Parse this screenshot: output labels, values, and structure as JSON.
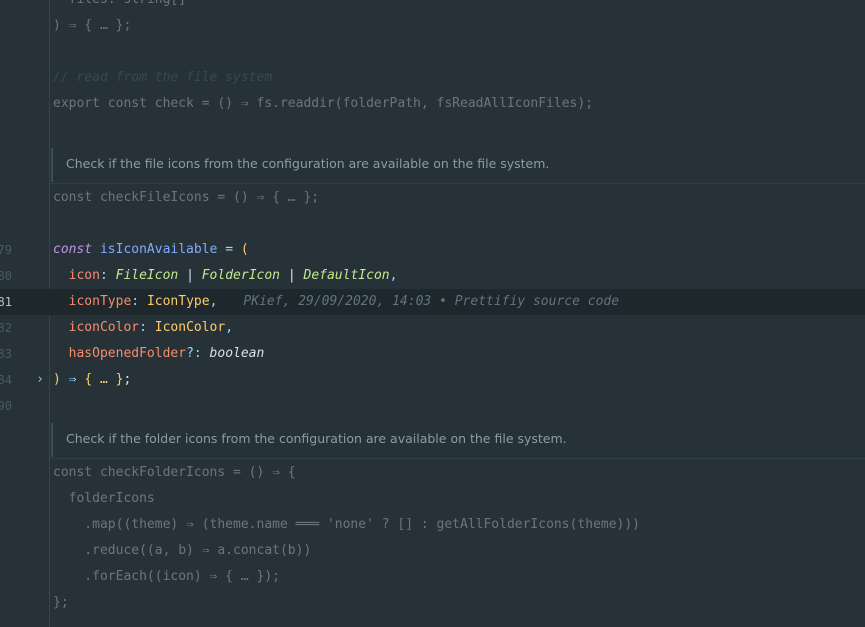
{
  "editor": {
    "lines": [
      {
        "n": "",
        "faded": true,
        "tokens": [
          {
            "t": "  files: string[]",
            "c": "c-plain"
          }
        ]
      },
      {
        "n": "",
        "faded": true,
        "tokens": [
          {
            "t": ") ⇒ { … };",
            "c": "c-plain"
          }
        ]
      },
      {
        "n": "",
        "faded": true,
        "tokens": []
      },
      {
        "n": "",
        "faded": true,
        "tokens": [
          {
            "t": "// read from the file system",
            "c": "c-comment"
          }
        ]
      },
      {
        "n": "",
        "faded": true,
        "tokens": [
          {
            "t": "export const check = () ⇒ fs.readdir(folderPath, fsReadAllIconFiles);",
            "c": "c-plain"
          }
        ]
      },
      {
        "n": "",
        "faded": true,
        "tokens": []
      },
      {
        "n": "",
        "doc": "Check if the file icons from the configuration are available on the file system."
      },
      {
        "n": "",
        "faded": true,
        "tokens": [
          {
            "t": "const checkFileIcons = () ⇒ { … };",
            "c": "c-plain"
          }
        ]
      },
      {
        "n": "",
        "faded": true,
        "tokens": []
      },
      {
        "n": "79",
        "faded": false,
        "tokens": [
          {
            "t": "const",
            "c": "c-kw"
          },
          {
            "t": " "
          },
          {
            "t": "isIconAvailable",
            "c": "c-fn"
          },
          {
            "t": " = ",
            "c": "c-punct"
          },
          {
            "t": "(",
            "c": "c-paren"
          }
        ]
      },
      {
        "n": "80",
        "faded": false,
        "tokens": [
          {
            "t": "  "
          },
          {
            "t": "icon",
            "c": "c-prop"
          },
          {
            "t": ": ",
            "c": "c-punct"
          },
          {
            "t": "FileIcon",
            "c": "c-type-i2"
          },
          {
            "t": " | ",
            "c": "c-plain"
          },
          {
            "t": "FolderIcon",
            "c": "c-type-i2"
          },
          {
            "t": " | ",
            "c": "c-plain"
          },
          {
            "t": "DefaultIcon",
            "c": "c-type-i2"
          },
          {
            "t": ",",
            "c": "c-punct"
          }
        ]
      },
      {
        "n": "81",
        "faded": false,
        "active": true,
        "tokens": [
          {
            "t": "  "
          },
          {
            "t": "iconType",
            "c": "c-prop"
          },
          {
            "t": ": ",
            "c": "c-punct"
          },
          {
            "t": "IconType",
            "c": "c-type"
          },
          {
            "t": ",",
            "c": "c-punct"
          }
        ],
        "blame": "PKief, 29/09/2020, 14:03 • Prettifiy source code"
      },
      {
        "n": "82",
        "faded": false,
        "tokens": [
          {
            "t": "  "
          },
          {
            "t": "iconColor",
            "c": "c-prop"
          },
          {
            "t": ": ",
            "c": "c-punct"
          },
          {
            "t": "IconColor",
            "c": "c-type"
          },
          {
            "t": ",",
            "c": "c-punct"
          }
        ]
      },
      {
        "n": "83",
        "faded": false,
        "tokens": [
          {
            "t": "  "
          },
          {
            "t": "hasOpenedFolder",
            "c": "c-prop"
          },
          {
            "t": "?: ",
            "c": "c-punct"
          },
          {
            "t": "boolean",
            "c": "c-bool"
          }
        ]
      },
      {
        "n": "84",
        "faded": false,
        "fold": "›",
        "tokens": [
          {
            "t": ")",
            "c": "c-paren"
          },
          {
            "t": " ⇒ ",
            "c": "c-punct"
          },
          {
            "t": "{ … }",
            "c": "c-paren"
          },
          {
            "t": ";",
            "c": "c-plain"
          }
        ]
      },
      {
        "n": "90",
        "faded": false,
        "tokens": []
      },
      {
        "n": "",
        "doc": "Check if the folder icons from the configuration are available on the file system."
      },
      {
        "n": "",
        "faded": true,
        "tokens": [
          {
            "t": "const checkFolderIcons = () ⇒ {",
            "c": "c-plain"
          }
        ]
      },
      {
        "n": "",
        "faded": true,
        "tokens": [
          {
            "t": "  folderIcons",
            "c": "c-plain"
          }
        ]
      },
      {
        "n": "",
        "faded": true,
        "tokens": [
          {
            "t": "    .map((theme) ⇒ (theme.name ═══ 'none' ? [] : getAllFolderIcons(theme)))",
            "c": "c-plain"
          }
        ]
      },
      {
        "n": "",
        "faded": true,
        "tokens": [
          {
            "t": "    .reduce((a, b) ⇒ a.concat(b))",
            "c": "c-plain"
          }
        ]
      },
      {
        "n": "",
        "faded": true,
        "tokens": [
          {
            "t": "    .forEach((icon) ⇒ { … });",
            "c": "c-plain"
          }
        ]
      },
      {
        "n": "",
        "faded": true,
        "tokens": [
          {
            "t": "};",
            "c": "c-plain"
          }
        ]
      }
    ]
  }
}
